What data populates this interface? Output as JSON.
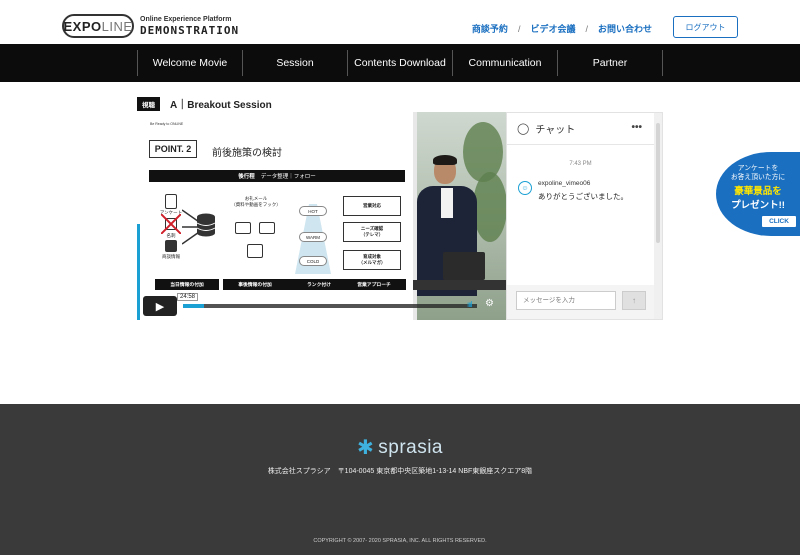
{
  "brand": {
    "logo_word_a": "EXPO",
    "logo_word_b": "LINE",
    "subtitle": "Online Experience Platform",
    "title": "DEMONSTRATION"
  },
  "top_links": [
    "商談予約",
    "ビデオ会議",
    "お問い合わせ"
  ],
  "top_link_separator": "/",
  "logout_label": "ログアウト",
  "nav": [
    "Welcome Movie",
    "Session",
    "Contents Download",
    "Communication",
    "Partner"
  ],
  "session": {
    "badge": "視聴",
    "title": "A｜Breakout Session"
  },
  "video": {
    "slide": {
      "tiny": "Be Ready to ONLINE",
      "point": "POINT. 2",
      "title": "前後施策の検討",
      "bar_main": "後行程",
      "bar_sub": "データ整理｜フォロー",
      "left_labels": [
        "アンケート",
        "名刺",
        "商談情報"
      ],
      "mail_label": "お礼メール\n（資料や動画をフック）",
      "stages": [
        "HOT",
        "WARM",
        "COLD"
      ],
      "right_boxes": [
        "営業対応",
        "ニーズ確認\n（テレマ）",
        "育成対象\n（メルマガ）"
      ],
      "footer_tabs": [
        "当日情報の付加",
        "事後情報の付加",
        "ランク付け",
        "営業アプローチ"
      ]
    },
    "time": "24:58",
    "progress": 0.07
  },
  "chat": {
    "title": "チャット",
    "menu": "•••",
    "timestamp": "7:43 PM",
    "user": "expoline_vimeo06",
    "message": "ありがとうございました。",
    "input_placeholder": "メッセージを入力",
    "send_icon": "up-arrow"
  },
  "survey": {
    "line1": "アンケートを",
    "line2": "お答え頂いた方に",
    "line3": "豪華景品を",
    "line4": "プレゼント!!",
    "click": "CLICK"
  },
  "footer": {
    "logo": "sprasia",
    "address": "株式会社スプラシア　〒104-0045 東京都中央区築地1-13-14 NBF東銀座スクエア8階",
    "copyright": "COPYRIGHT © 2007- 2020 SPRASIA, INC. ALL RIGHTS RESERVED."
  },
  "colors": {
    "accent": "#1a6fc0",
    "nav_bg": "#0c0c0c",
    "footer_bg": "#3a3a3a",
    "video_accent": "#1ba0d4"
  }
}
